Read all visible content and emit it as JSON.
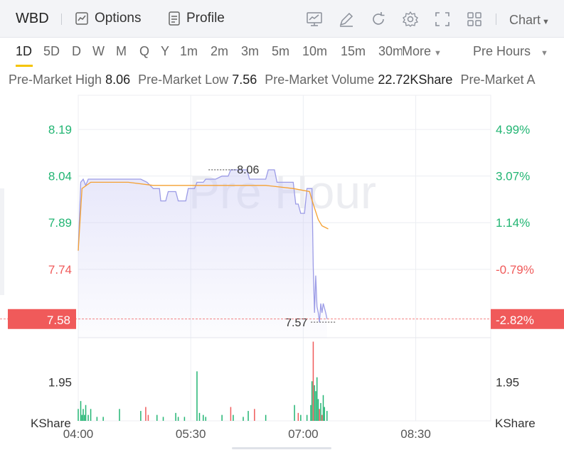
{
  "header": {
    "symbol": "WBD",
    "options_label": "Options",
    "profile_label": "Profile",
    "chart_label": "Chart"
  },
  "periods": {
    "items": [
      "1D",
      "5D",
      "D",
      "W",
      "M",
      "Q",
      "Y",
      "1m",
      "2m",
      "3m",
      "5m",
      "10m",
      "15m",
      "30m"
    ],
    "active": "1D",
    "more_label": "More",
    "session_label": "Pre Hours"
  },
  "stats": {
    "high_label": "Pre-Market High",
    "high_value": "8.06",
    "low_label": "Pre-Market Low",
    "low_value": "7.56",
    "volume_label": "Pre-Market Volume",
    "volume_value": "22.72KShare",
    "avg_label": "Pre-Market A"
  },
  "colors": {
    "up": "#22b573",
    "down": "#f05a5a",
    "price_line": "#9b9be6",
    "avg_line": "#f5a030",
    "accent": "#f5c400"
  },
  "chart_data": {
    "type": "line",
    "watermark": "Pre Hour",
    "x_ticks": [
      "04:00",
      "05:30",
      "07:00",
      "08:30"
    ],
    "x_domain_minutes": [
      240,
      570
    ],
    "y_ticks": [
      "8.19",
      "8.04",
      "7.89",
      "7.74"
    ],
    "y_ticks_right": [
      "4.99%",
      "3.07%",
      "1.14%",
      "-0.79%"
    ],
    "y_range": [
      7.52,
      8.3
    ],
    "prev_close": 7.8,
    "current_price": "7.58",
    "current_pct": "-2.82%",
    "max_label": "8.06",
    "max_time": 367,
    "min_label": "7.57",
    "min_time": 425,
    "volume_unit": "KShare",
    "volume_tick": "1.95",
    "volume_range": [
      0,
      4.2
    ],
    "price_series": [
      [
        240,
        7.8
      ],
      [
        242,
        8.02
      ],
      [
        244,
        8.03
      ],
      [
        246,
        8.01
      ],
      [
        248,
        8.03
      ],
      [
        250,
        8.03
      ],
      [
        270,
        8.03
      ],
      [
        290,
        8.03
      ],
      [
        295,
        8.02
      ],
      [
        300,
        8.0
      ],
      [
        305,
        8.0
      ],
      [
        306,
        7.96
      ],
      [
        310,
        7.96
      ],
      [
        312,
        7.99
      ],
      [
        318,
        7.99
      ],
      [
        320,
        7.96
      ],
      [
        326,
        7.96
      ],
      [
        328,
        8.0
      ],
      [
        333,
        8.0
      ],
      [
        335,
        8.02
      ],
      [
        340,
        8.02
      ],
      [
        342,
        8.03
      ],
      [
        350,
        8.03
      ],
      [
        355,
        8.04
      ],
      [
        360,
        8.04
      ],
      [
        362,
        8.06
      ],
      [
        375,
        8.06
      ],
      [
        377,
        8.03
      ],
      [
        390,
        8.03
      ],
      [
        392,
        8.06
      ],
      [
        397,
        8.06
      ],
      [
        399,
        8.02
      ],
      [
        412,
        8.02
      ],
      [
        414,
        7.95
      ],
      [
        416,
        7.95
      ],
      [
        418,
        7.92
      ],
      [
        421,
        7.92
      ],
      [
        423,
        8.0
      ],
      [
        427,
        8.0
      ],
      [
        428,
        7.75
      ],
      [
        429,
        7.6
      ],
      [
        430,
        7.72
      ],
      [
        431,
        7.62
      ],
      [
        432,
        7.6
      ],
      [
        433,
        7.57
      ],
      [
        434,
        7.63
      ],
      [
        435,
        7.6
      ],
      [
        436,
        7.63
      ],
      [
        438,
        7.6
      ],
      [
        439,
        7.58
      ]
    ],
    "avg_series": [
      [
        240,
        7.8
      ],
      [
        243,
        8.0
      ],
      [
        250,
        8.02
      ],
      [
        280,
        8.02
      ],
      [
        300,
        8.01
      ],
      [
        330,
        8.01
      ],
      [
        360,
        8.01
      ],
      [
        390,
        8.01
      ],
      [
        412,
        8.0
      ],
      [
        425,
        7.99
      ],
      [
        428,
        7.95
      ],
      [
        432,
        7.9
      ],
      [
        435,
        7.88
      ],
      [
        440,
        7.87
      ]
    ],
    "volume_bars": [
      [
        240,
        0.6,
        "up"
      ],
      [
        242,
        1.0,
        "up"
      ],
      [
        243,
        0.3,
        "up"
      ],
      [
        244,
        0.6,
        "up"
      ],
      [
        245,
        0.3,
        "up"
      ],
      [
        246,
        0.8,
        "up"
      ],
      [
        248,
        0.3,
        "up"
      ],
      [
        250,
        0.6,
        "up"
      ],
      [
        255,
        0.2,
        "up"
      ],
      [
        260,
        0.2,
        "up"
      ],
      [
        273,
        0.6,
        "up"
      ],
      [
        290,
        0.5,
        "up"
      ],
      [
        294,
        0.7,
        "down"
      ],
      [
        296,
        0.3,
        "down"
      ],
      [
        303,
        0.3,
        "up"
      ],
      [
        308,
        0.2,
        "up"
      ],
      [
        318,
        0.4,
        "up"
      ],
      [
        320,
        0.2,
        "up"
      ],
      [
        325,
        0.2,
        "up"
      ],
      [
        335,
        2.5,
        "up"
      ],
      [
        337,
        0.4,
        "up"
      ],
      [
        340,
        0.3,
        "up"
      ],
      [
        342,
        0.2,
        "up"
      ],
      [
        355,
        0.3,
        "up"
      ],
      [
        362,
        0.7,
        "down"
      ],
      [
        364,
        0.3,
        "up"
      ],
      [
        372,
        0.2,
        "up"
      ],
      [
        376,
        0.5,
        "up"
      ],
      [
        381,
        0.6,
        "down"
      ],
      [
        390,
        0.3,
        "up"
      ],
      [
        413,
        0.8,
        "up"
      ],
      [
        416,
        0.4,
        "down"
      ],
      [
        418,
        0.3,
        "up"
      ],
      [
        423,
        0.3,
        "up"
      ],
      [
        426,
        0.8,
        "up"
      ],
      [
        427,
        2.0,
        "up"
      ],
      [
        428,
        4.0,
        "down"
      ],
      [
        429,
        1.8,
        "up"
      ],
      [
        430,
        1.5,
        "up"
      ],
      [
        431,
        2.2,
        "up"
      ],
      [
        432,
        1.1,
        "up"
      ],
      [
        433,
        0.6,
        "down"
      ],
      [
        434,
        0.9,
        "up"
      ],
      [
        435,
        0.3,
        "down"
      ],
      [
        436,
        1.3,
        "up"
      ],
      [
        437,
        0.7,
        "up"
      ],
      [
        439,
        0.5,
        "up"
      ]
    ]
  }
}
